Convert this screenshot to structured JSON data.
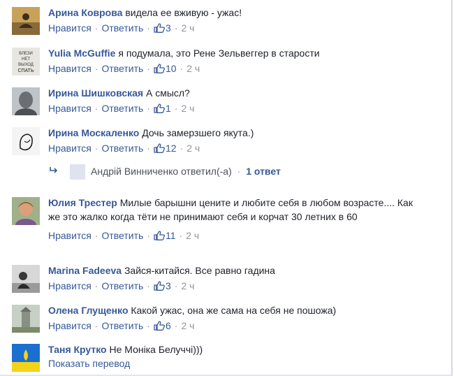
{
  "action_labels": {
    "like": "Нравится",
    "reply": "Ответить",
    "separator": "·"
  },
  "comments": [
    {
      "author": "Арина Коврова",
      "text": "видела ее вживую - ужас!",
      "likes": "3",
      "time": "2 ч"
    },
    {
      "author": "Yulia McGuffie",
      "text": "я подумала, это Рене Зельвеггер в старости",
      "likes": "10",
      "time": "2 ч",
      "avatar_text": "ВЛЕЗИ НЕТ ВЫХОД СПАТЬ"
    },
    {
      "author": "Ирина Шишковская",
      "text": "А смысл?",
      "likes": "1",
      "time": "2 ч"
    },
    {
      "author": "Ирина Москаленко",
      "text": "Дочь замерзшего якута.)",
      "likes": "12",
      "time": "2 ч"
    },
    {
      "author": "Юлия Трестер",
      "text": "Милые барышни цените и любите себя в любом возрасте.... Как же это жалко когда тёти не принимают себя и корчат 30 летних в 60",
      "likes": "11",
      "time": "2 ч"
    },
    {
      "author": "Marina Fadeeva",
      "text": "Зайся-китайся. Все равно гадина",
      "likes": "3",
      "time": "2 ч"
    },
    {
      "author": "Олена Глущенко",
      "text": "Какой ужас, она же сама на себя не пошожа)",
      "likes": "6",
      "time": "2 ч"
    },
    {
      "author": "Таня Крутко",
      "text": "Не Моніка Белуччі)))",
      "translate": "Показать перевод"
    }
  ],
  "reply_thread": {
    "author": "Андрій Винниченко",
    "verb": "ответил(-а)",
    "count": "1 ответ"
  },
  "colors": {
    "link": "#365899",
    "meta": "#90949c",
    "text": "#1d2129"
  }
}
